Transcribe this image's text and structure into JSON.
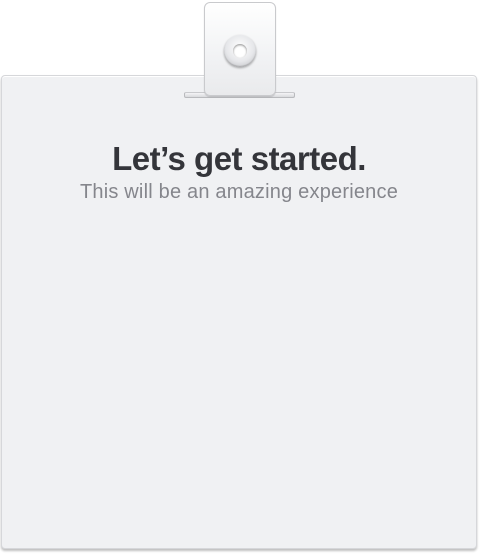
{
  "card": {
    "title": "Let’s get started.",
    "subtitle": "This will be an amazing experience"
  },
  "colors": {
    "card_background": "#f0f1f3",
    "title_text": "#34353a",
    "subtitle_text": "#85868c"
  },
  "icons": {
    "clip": "badge-clip-icon",
    "grommet": "grommet-hole-icon"
  }
}
